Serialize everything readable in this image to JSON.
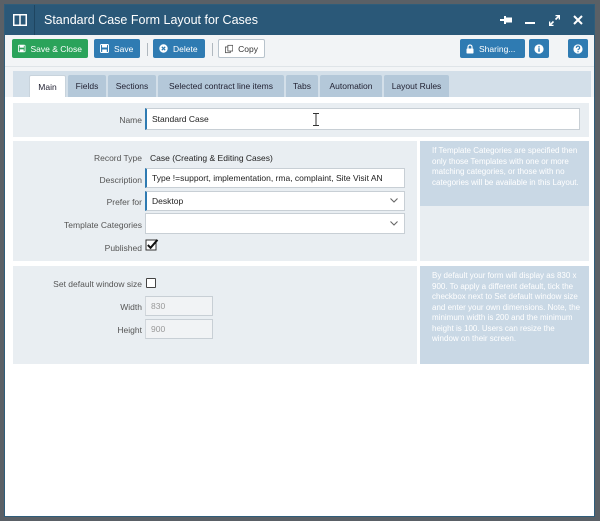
{
  "window": {
    "title": "Standard Case Form Layout for Cases"
  },
  "toolbar": {
    "save_close_label": "Save & Close",
    "save_label": "Save",
    "delete_label": "Delete",
    "copy_label": "Copy",
    "sharing_label": "Sharing..."
  },
  "tabs": [
    {
      "label": "Main",
      "active": true
    },
    {
      "label": "Fields"
    },
    {
      "label": "Sections"
    },
    {
      "label": "Selected contract line items"
    },
    {
      "label": "Tabs"
    },
    {
      "label": "Automation"
    },
    {
      "label": "Layout Rules"
    }
  ],
  "form": {
    "name_label": "Name",
    "name_value": "Standard Case",
    "record_type_label": "Record Type",
    "record_type_value": "Case (Creating & Editing Cases)",
    "description_label": "Description",
    "description_value": "Type !=support, implementation, rma, complaint, Site Visit AN",
    "prefer_for_label": "Prefer for",
    "prefer_for_value": "Desktop",
    "template_categories_label": "Template Categories",
    "template_categories_value": "",
    "published_label": "Published",
    "published_checked": true,
    "template_info": "If Template Categories are specified then only those Templates with one or more matching categories, or those with no categories will be available in this Layout."
  },
  "window_size": {
    "default_label": "Set default window size",
    "default_checked": false,
    "width_label": "Width",
    "width_value": "830",
    "height_label": "Height",
    "height_value": "900",
    "info": "By default your form will display as 830 x 900. To apply a different default, tick the checkbox next to Set default window size and enter your own dimensions. Note, the minimum width is 200 and the minimum height is 100. Users can resize the window on their screen."
  },
  "colors": {
    "titlebar": "#2a5878",
    "primary_button": "#2f7bb2",
    "save_close_button": "#2aa35a",
    "panel": "#e9eef2",
    "info_panel": "#c9d8e5",
    "tab": "#b4c8d9"
  }
}
